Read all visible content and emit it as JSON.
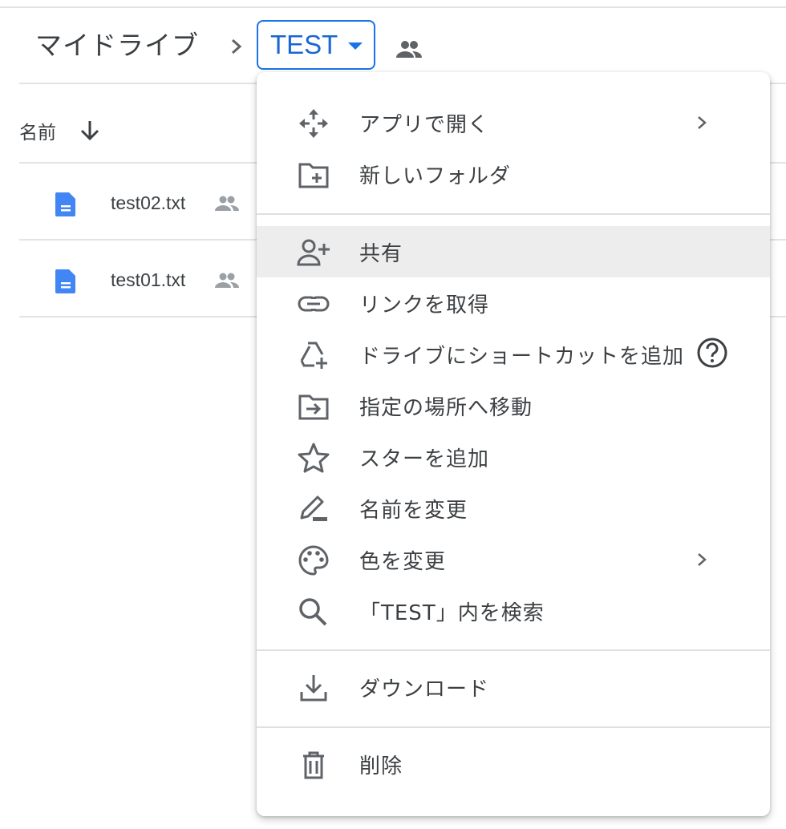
{
  "breadcrumb": {
    "root": "マイドライブ",
    "current": "TEST"
  },
  "list": {
    "column_name": "名前",
    "files": [
      {
        "name": "test02.txt"
      },
      {
        "name": "test01.txt"
      }
    ]
  },
  "menu": {
    "open_with": "アプリで開く",
    "new_folder": "新しいフォルダ",
    "share": "共有",
    "get_link": "リンクを取得",
    "add_shortcut": "ドライブにショートカットを追加",
    "move_to": "指定の場所へ移動",
    "add_star": "スターを追加",
    "rename": "名前を変更",
    "change_color": "色を変更",
    "search_in": "「TEST」内を検索",
    "download": "ダウンロード",
    "delete": "削除"
  },
  "colors": {
    "accent": "#1a73e8",
    "doc_icon": "#4285f4",
    "highlight": "#ededed",
    "icon_gray": "#5f6368"
  }
}
